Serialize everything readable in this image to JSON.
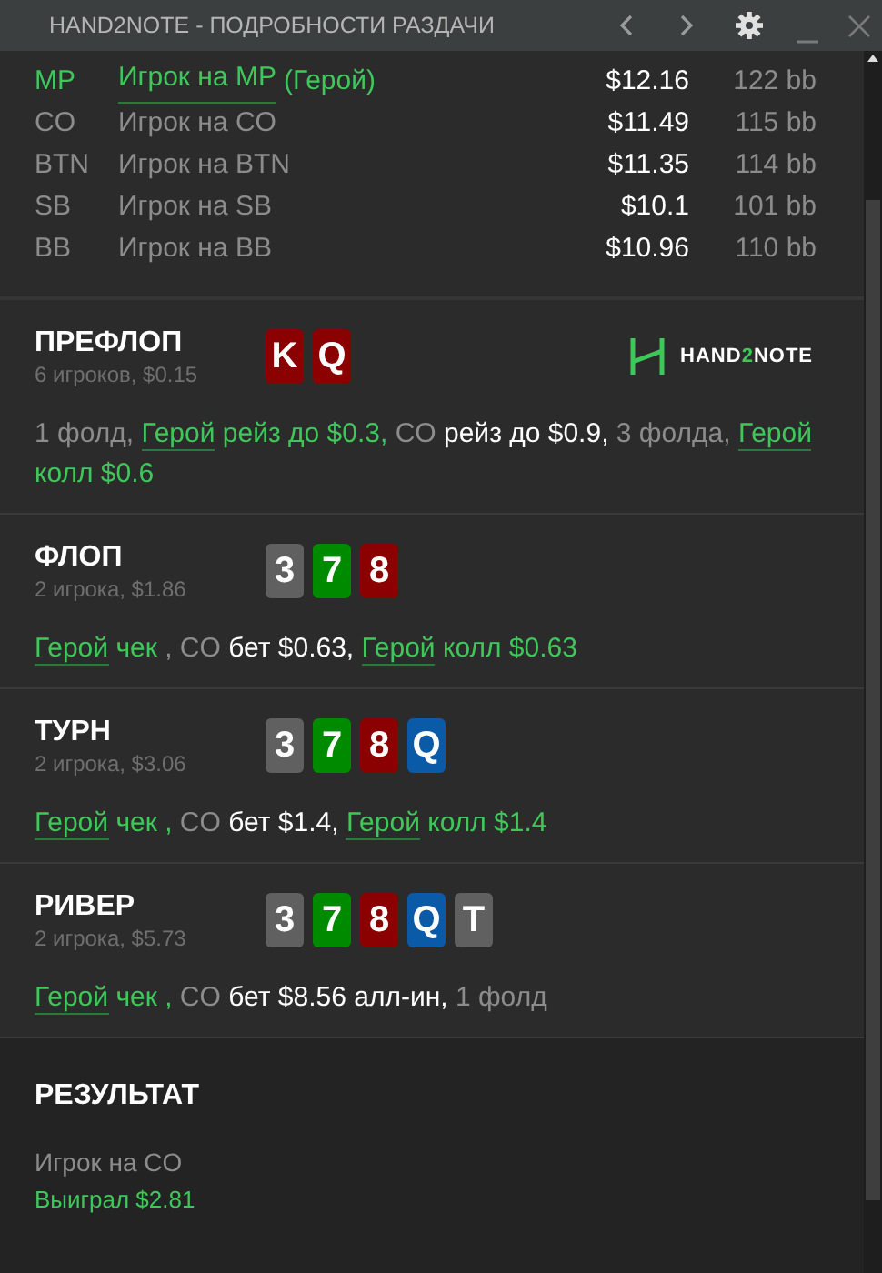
{
  "window": {
    "title": "HAND2NOTE - ПОДРОБНОСТИ РАЗДАЧИ"
  },
  "players": [
    {
      "position": "MP",
      "name": "Игрок на MP",
      "hero": true,
      "hero_tag": "(Герой)",
      "stack": "$12.16",
      "bb": "122 bb"
    },
    {
      "position": "CO",
      "name": "Игрок на CO",
      "hero": false,
      "stack": "$11.49",
      "bb": "115 bb"
    },
    {
      "position": "BTN",
      "name": "Игрок на BTN",
      "hero": false,
      "stack": "$11.35",
      "bb": "114 bb"
    },
    {
      "position": "SB",
      "name": "Игрок на SB",
      "hero": false,
      "stack": "$10.1",
      "bb": "101 bb"
    },
    {
      "position": "BB",
      "name": "Игрок на BB",
      "hero": false,
      "stack": "$10.96",
      "bb": "110 bb"
    }
  ],
  "logo": {
    "parts": [
      {
        "text": "HAND",
        "accent": false
      },
      {
        "text": "2",
        "accent": true
      },
      {
        "text": "NOTE",
        "accent": false
      }
    ]
  },
  "streets": [
    {
      "title": "ПРЕФЛОП",
      "subtitle": "6 игроков, $0.15",
      "logo": true,
      "cards": [
        {
          "rank": "K",
          "color": "#8b0000"
        },
        {
          "rank": "Q",
          "color": "#8b0000"
        }
      ],
      "actions": [
        {
          "kind": "other",
          "text": "1 фолд, "
        },
        {
          "kind": "hero",
          "text": "Герой"
        },
        {
          "kind": "hero_action",
          "text": " рейз до $0.3, "
        },
        {
          "kind": "other",
          "text": "CO "
        },
        {
          "kind": "action",
          "text": "рейз до $0.9, "
        },
        {
          "kind": "other",
          "text": "3 фолда, "
        },
        {
          "kind": "hero",
          "text": "Герой"
        },
        {
          "kind": "hero_action",
          "text": " колл $0.6"
        }
      ]
    },
    {
      "title": "ФЛОП",
      "subtitle": "2 игрока, $1.86",
      "logo": false,
      "cards": [
        {
          "rank": "3",
          "color": "#606060"
        },
        {
          "rank": "7",
          "color": "#008a00"
        },
        {
          "rank": "8",
          "color": "#8b0000"
        }
      ],
      "actions": [
        {
          "kind": "hero",
          "text": "Герой"
        },
        {
          "kind": "hero_action",
          "text": " чек"
        },
        {
          "kind": "other",
          "text": " , CO "
        },
        {
          "kind": "action",
          "text": "бет $0.63, "
        },
        {
          "kind": "hero",
          "text": "Герой"
        },
        {
          "kind": "hero_action",
          "text": " колл $0.63"
        }
      ]
    },
    {
      "title": "ТУРН",
      "subtitle": "2 игрока, $3.06",
      "logo": false,
      "cards": [
        {
          "rank": "3",
          "color": "#606060"
        },
        {
          "rank": "7",
          "color": "#008a00"
        },
        {
          "rank": "8",
          "color": "#8b0000"
        },
        {
          "rank": "Q",
          "color": "#0a5aa8"
        }
      ],
      "actions": [
        {
          "kind": "hero",
          "text": "Герой"
        },
        {
          "kind": "hero_action",
          "text": " чек , "
        },
        {
          "kind": "other",
          "text": "CO "
        },
        {
          "kind": "action",
          "text": "бет $1.4, "
        },
        {
          "kind": "hero",
          "text": "Герой"
        },
        {
          "kind": "hero_action",
          "text": " колл $1.4"
        }
      ]
    },
    {
      "title": "РИВЕР",
      "subtitle": "2 игрока, $5.73",
      "logo": false,
      "cards": [
        {
          "rank": "3",
          "color": "#606060"
        },
        {
          "rank": "7",
          "color": "#008a00"
        },
        {
          "rank": "8",
          "color": "#8b0000"
        },
        {
          "rank": "Q",
          "color": "#0a5aa8"
        },
        {
          "rank": "T",
          "color": "#606060"
        }
      ],
      "actions": [
        {
          "kind": "hero",
          "text": "Герой"
        },
        {
          "kind": "hero_action",
          "text": " чек , "
        },
        {
          "kind": "other",
          "text": "CO "
        },
        {
          "kind": "action",
          "text": "бет $8.56 алл-ин, "
        },
        {
          "kind": "other",
          "text": "1 фолд"
        }
      ]
    }
  ],
  "result": {
    "title": "РЕЗУЛЬТАТ",
    "winner": "Игрок на CO",
    "amount": "Выиграл $2.81"
  }
}
